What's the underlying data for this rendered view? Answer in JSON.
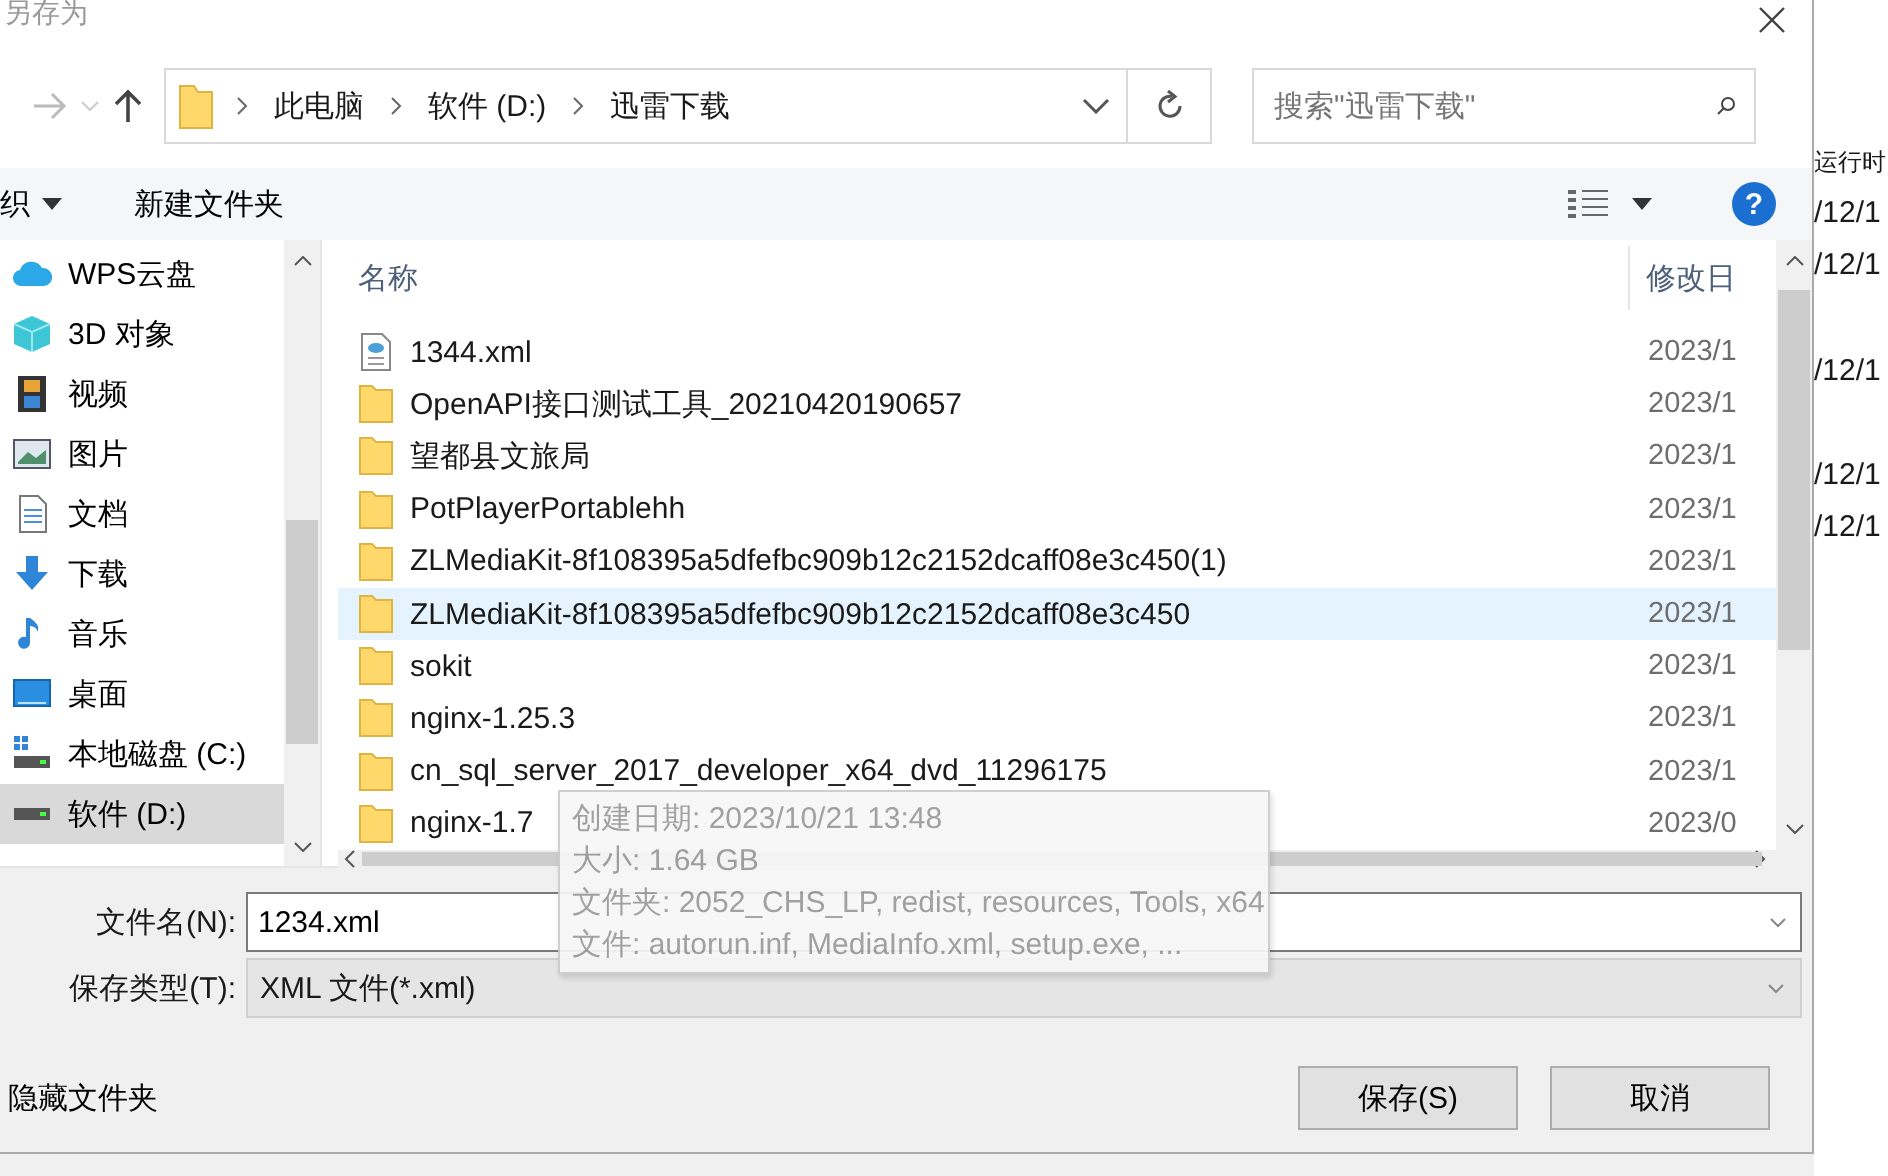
{
  "window": {
    "title": "另存为"
  },
  "nav": {
    "path": [
      "此电脑",
      "软件 (D:)",
      "迅雷下载"
    ],
    "search": {
      "placeholder": "搜索\"迅雷下载\""
    }
  },
  "toolbar": {
    "organize": "织",
    "new_folder": "新建文件夹",
    "help": "?"
  },
  "sidebar": {
    "items": [
      {
        "label": "WPS云盘",
        "selected": false
      },
      {
        "label": "3D 对象",
        "selected": false
      },
      {
        "label": "视频",
        "selected": false
      },
      {
        "label": "图片",
        "selected": false
      },
      {
        "label": "文档",
        "selected": false
      },
      {
        "label": "下载",
        "selected": false
      },
      {
        "label": "音乐",
        "selected": false
      },
      {
        "label": "桌面",
        "selected": false
      },
      {
        "label": "本地磁盘 (C:)",
        "selected": false
      },
      {
        "label": "软件 (D:)",
        "selected": true
      }
    ]
  },
  "list": {
    "columns": [
      "名称",
      "修改日"
    ],
    "rows": [
      {
        "name": "1344.xml",
        "kind": "file",
        "date": "2023/1",
        "highlighted": false
      },
      {
        "name": "OpenAPI接口测试工具_20210420190657",
        "kind": "folder",
        "date": "2023/1",
        "highlighted": false
      },
      {
        "name": "望都县文旅局",
        "kind": "folder",
        "date": "2023/1",
        "highlighted": false
      },
      {
        "name": "PotPlayerPortablehh",
        "kind": "folder",
        "date": "2023/1",
        "highlighted": false
      },
      {
        "name": "ZLMediaKit-8f108395a5dfefbc909b12c2152dcaff08e3c450(1)",
        "kind": "folder",
        "date": "2023/1",
        "highlighted": false
      },
      {
        "name": "ZLMediaKit-8f108395a5dfefbc909b12c2152dcaff08e3c450",
        "kind": "folder",
        "date": "2023/1",
        "highlighted": true
      },
      {
        "name": "sokit",
        "kind": "folder",
        "date": "2023/1",
        "highlighted": false
      },
      {
        "name": "nginx-1.25.3",
        "kind": "folder",
        "date": "2023/1",
        "highlighted": false
      },
      {
        "name": "cn_sql_server_2017_developer_x64_dvd_11296175",
        "kind": "folder",
        "date": "2023/1",
        "highlighted": false
      },
      {
        "name": "nginx-1.7",
        "kind": "folder",
        "date": "2023/0",
        "highlighted": false
      }
    ]
  },
  "tooltip": {
    "lines": [
      "创建日期: 2023/10/21 13:48",
      "大小: 1.64 GB",
      "文件夹: 2052_CHS_LP, redist, resources, Tools, x64",
      "文件: autorun.inf, MediaInfo.xml, setup.exe, ..."
    ]
  },
  "form": {
    "filename": {
      "label": "文件名(N):",
      "value": "1234.xml"
    },
    "filetype": {
      "label": "保存类型(T):",
      "value": "XML 文件(*.xml)"
    }
  },
  "hide_folders": "隐藏文件夹",
  "buttons": [
    {
      "label": "保存(S)"
    },
    {
      "label": "取消"
    }
  ],
  "background_window": {
    "texts": [
      "运行时",
      "/12/1",
      "/12/1",
      "/12/1",
      "/12/1",
      "/12/1"
    ]
  }
}
